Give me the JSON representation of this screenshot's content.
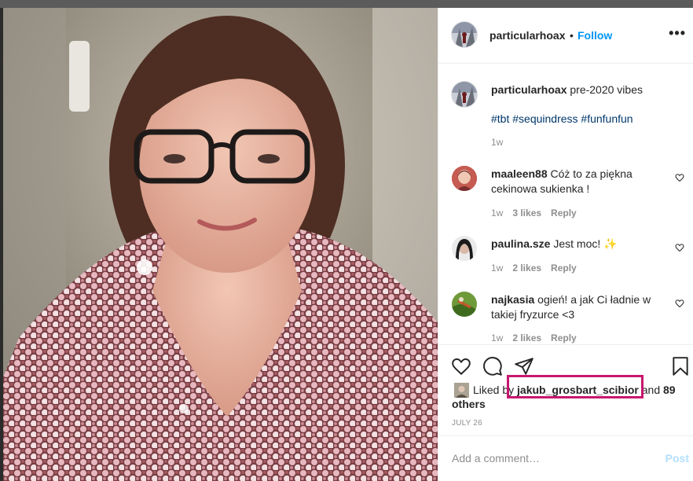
{
  "post": {
    "author": "particularhoax",
    "follow_label": "Follow",
    "separator": "•",
    "more_icon": "more-horizontal-icon",
    "caption_text": "pre-2020 vibes",
    "hashtags": [
      "#tbt",
      "#sequindress",
      "#funfunfun"
    ],
    "caption_time": "1w"
  },
  "comments": [
    {
      "user": "maaleen88",
      "text": "Cóż to za piękna cekinowa sukienka !",
      "time": "1w",
      "likes": "3 likes",
      "reply": "Reply"
    },
    {
      "user": "paulina.sze",
      "text": "Jest moc! ✨",
      "time": "1w",
      "likes": "2 likes",
      "reply": "Reply"
    },
    {
      "user": "najkasia",
      "text": "ogień! a jak Ci ładnie w takiej fryzurce <3",
      "time": "1w",
      "likes": "2 likes",
      "reply": "Reply"
    }
  ],
  "likes": {
    "prefix": "Liked by",
    "first_user": "jakub_grosbart_scibior",
    "conjunction": "and",
    "others": "89 others"
  },
  "date": "JULY 26",
  "composer": {
    "placeholder": "Add a comment…",
    "post_label": "Post"
  },
  "colors": {
    "accent": "#0095f6",
    "highlight": "#c8176f",
    "hashtag": "#00376b",
    "muted": "#8e8e8e"
  }
}
